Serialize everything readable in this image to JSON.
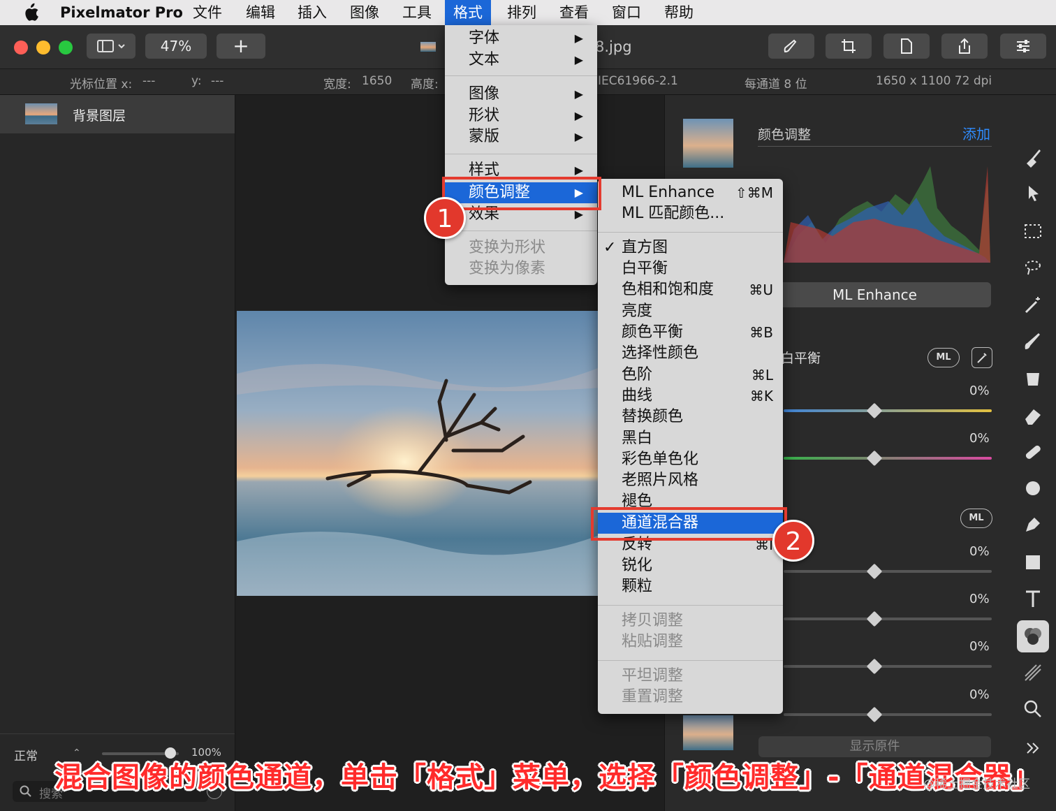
{
  "menubar": {
    "app_name": "Pixelmator Pro",
    "items": [
      "文件",
      "编辑",
      "插入",
      "图像",
      "工具",
      "格式",
      "排列",
      "查看",
      "窗口",
      "帮助"
    ]
  },
  "toolbar": {
    "zoom": "47%",
    "add": "+",
    "doc_title": "8.jpg"
  },
  "infobar": {
    "cursor_x_label": "光标位置 x:",
    "cursor_x_value": "---",
    "cursor_y_label": "y:",
    "cursor_y_value": "---",
    "width_label": "宽度:",
    "width_value": "1650",
    "height_label": "高度:",
    "color_profile": "IEC61966-2.1",
    "bit_depth": "每通道 8 位",
    "dimensions": "1650 x 1100 72 dpi"
  },
  "layers": {
    "layer_name": "背景图层",
    "blend_mode": "正常",
    "opacity": "100%",
    "search_placeholder": "搜索"
  },
  "right_panel": {
    "section_title": "颜色调整",
    "add_link": "添加",
    "ml_enhance_button": "ML Enhance",
    "white_balance_label": "白平衡",
    "ml_badge": "ML",
    "percent_values": [
      "0%",
      "0%",
      "0%",
      "0%",
      "0%",
      "0%"
    ],
    "show_original": "显示原件"
  },
  "format_menu": {
    "items": [
      {
        "label": "字体",
        "submenu": true
      },
      {
        "label": "文本",
        "submenu": true
      },
      {
        "label": "图像",
        "submenu": true
      },
      {
        "label": "形状",
        "submenu": true
      },
      {
        "label": "蒙版",
        "submenu": true
      },
      {
        "label": "样式",
        "submenu": true
      },
      {
        "label": "颜色调整",
        "submenu": true
      },
      {
        "label": "效果",
        "submenu": true
      },
      {
        "label": "变换为形状",
        "disabled": true
      },
      {
        "label": "变换为像素",
        "disabled": true
      }
    ]
  },
  "color_adjust_submenu": {
    "items": [
      {
        "label": "ML Enhance",
        "shortcut": "⇧⌘M"
      },
      {
        "label": "ML 匹配颜色..."
      },
      {
        "label": "直方图",
        "checked": true
      },
      {
        "label": "白平衡"
      },
      {
        "label": "色相和饱和度",
        "shortcut": "⌘U"
      },
      {
        "label": "亮度"
      },
      {
        "label": "颜色平衡",
        "shortcut": "⌘B"
      },
      {
        "label": "选择性颜色"
      },
      {
        "label": "色阶",
        "shortcut": "⌘L"
      },
      {
        "label": "曲线",
        "shortcut": "⌘K"
      },
      {
        "label": "替换颜色"
      },
      {
        "label": "黑白"
      },
      {
        "label": "彩色单色化"
      },
      {
        "label": "老照片风格"
      },
      {
        "label": "褪色"
      },
      {
        "label": "通道混合器"
      },
      {
        "label": "反转",
        "shortcut": "⌘I"
      },
      {
        "label": "锐化"
      },
      {
        "label": "颗粒"
      },
      {
        "label": "拷贝调整",
        "disabled": true
      },
      {
        "label": "粘贴调整",
        "disabled": true
      },
      {
        "label": "平坦调整",
        "disabled": true
      },
      {
        "label": "重置调整",
        "disabled": true
      }
    ]
  },
  "annotations": {
    "step1": "1",
    "step2": "2",
    "caption": "混合图像的颜色通道，单击「格式」菜单，选择「颜色调整」-「通道混合器」",
    "watermark": "@稀土掘金技术社区"
  },
  "colors": {
    "highlight": "#1b67d8",
    "annotation_red": "#e43b2f",
    "link_blue": "#2f8cff"
  },
  "icons": [
    "apple-icon",
    "sidebar-icon",
    "brush-icon",
    "crop-icon",
    "document-icon",
    "share-icon",
    "sliders-icon",
    "paint-icon",
    "arrow-icon",
    "selection-icon",
    "lasso-icon",
    "magic-wand-icon",
    "paintbrush-icon",
    "bucket-icon",
    "eraser-icon",
    "bandage-icon",
    "clone-icon",
    "pen-icon",
    "shape-icon",
    "text-icon",
    "color-adjust-icon",
    "effects-icon",
    "zoom-icon",
    "more-icon",
    "eyedropper-icon",
    "search-icon"
  ]
}
